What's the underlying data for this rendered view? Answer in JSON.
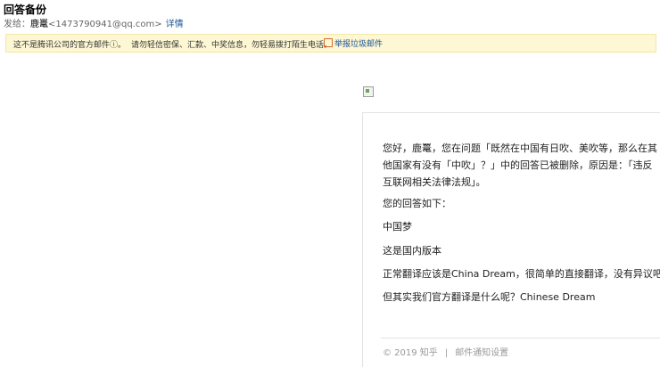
{
  "header": {
    "subject": "回答备份",
    "from_label": "发给：",
    "sender_name": "鹿鼍",
    "sender_email": "<1473790941@qq.com>",
    "details_link": "详情"
  },
  "warning": {
    "text1": "这不是腾讯公司的官方邮件ⓘ。",
    "text2": "请勿轻信密保、汇款、中奖信息，勿轻易拨打陌生电话。",
    "report_link": "举报垃圾邮件"
  },
  "email": {
    "greeting": "您好，鹿鼍，您在问题「既然在中国有日吹、美吹等，那么在其他国家有没有「中吹」？」中的回答已被删除，原因是：「违反互联网相关法律法规」。",
    "answer_label": "您的回答如下：",
    "answer_lines": [
      "中国梦",
      "这是国内版本",
      "正常翻译应该是China Dream，很简单的直接翻译，没有异议吧？",
      "但其实我们官方翻译是什么呢？Chinese Dream"
    ]
  },
  "footer": {
    "copyright": "© 2019 知乎",
    "separator": "|",
    "settings_link": "邮件通知设置"
  },
  "colors": {
    "link": "#1e5494",
    "warning_bg": "#fdf7d3",
    "border": "#e2e2e2"
  }
}
